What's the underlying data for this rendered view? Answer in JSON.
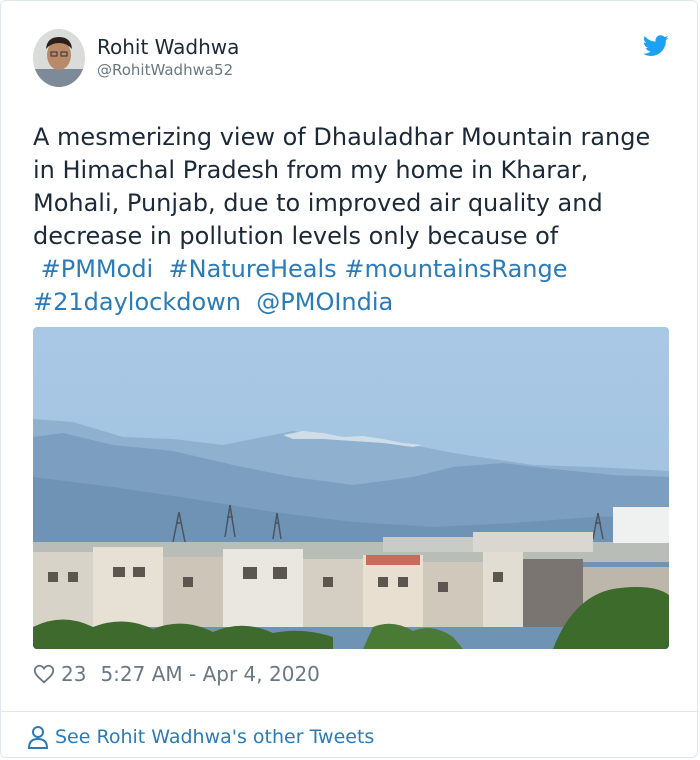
{
  "user": {
    "name": "Rohit Wadhwa",
    "handle": "@RohitWadhwa52"
  },
  "tweet": {
    "text_lines": [
      "A mesmerizing view of Dhauladhar Mountain range",
      "in Himachal Pradesh from my home in Kharar,",
      "Mohali, Punjab, due to improved air quality and",
      "decrease in pollution levels only because of"
    ],
    "hashtags": [
      "#PMModi",
      "#NatureHeals",
      "#mountainsRange",
      "#21daylockdown"
    ],
    "mention": "@PMOIndia"
  },
  "meta": {
    "likes": "23",
    "timestamp": "5:27 AM - Apr 4, 2020"
  },
  "footer": {
    "label": "See Rohit Wadhwa's other Tweets"
  },
  "icons": {
    "brand": "twitter-bird-icon",
    "like": "heart-icon",
    "profile": "person-icon"
  },
  "colors": {
    "link": "#2b7bb9",
    "twitter_blue": "#1da1f2",
    "text": "#1c2938",
    "muted": "#697882",
    "border": "#e1e8ed"
  }
}
